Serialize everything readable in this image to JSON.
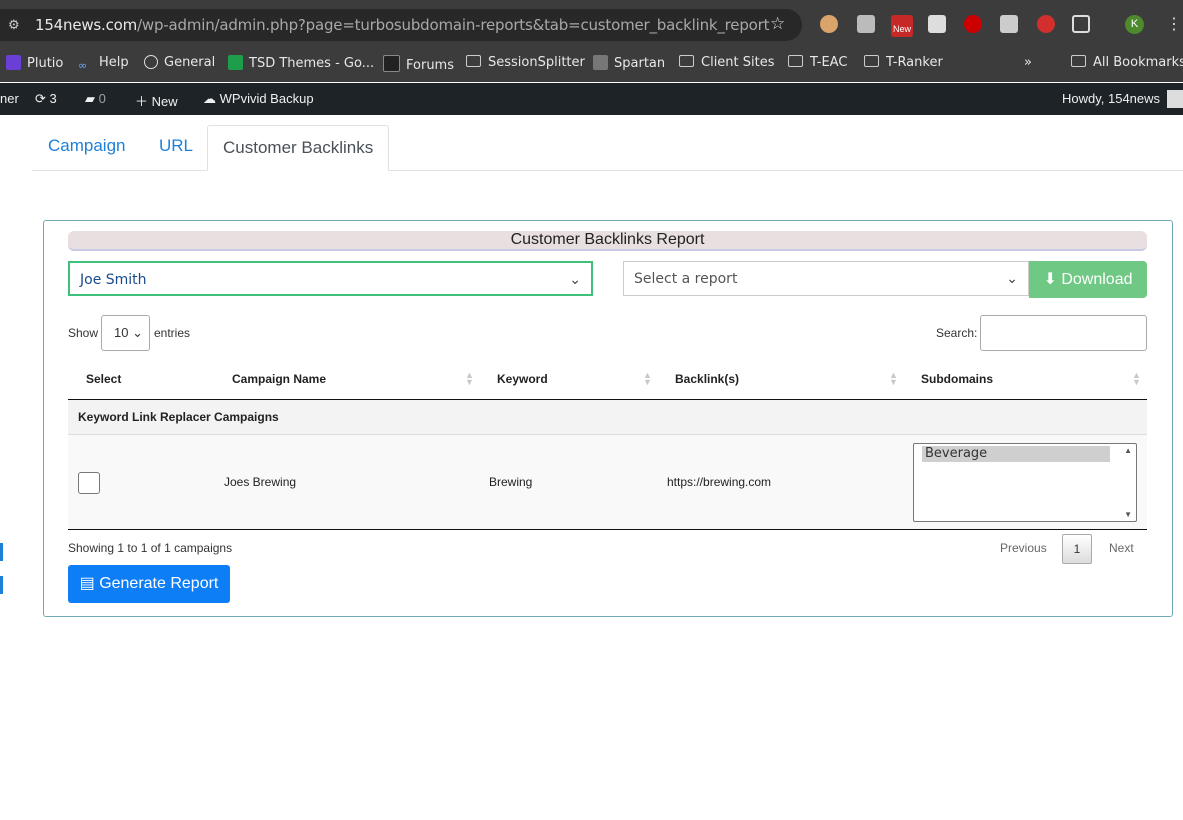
{
  "browser": {
    "url_host": "154news.com",
    "url_path": "/wp-admin/admin.php?page=turbosubdomain-reports&tab=customer_backlink_report",
    "extension_badge": "New",
    "profile_initial": "K",
    "bookmarks": [
      "Plutio",
      "Help",
      "General",
      "TSD Themes - Go...",
      "Forums",
      "SessionSplitter",
      "Spartan",
      "Client Sites",
      "T-EAC",
      "T-Ranker"
    ],
    "all_bookmarks": "All Bookmarks"
  },
  "adminbar": {
    "site_fragment": "ner",
    "updates": "3",
    "comments": "0",
    "new_label": "New",
    "plugin_label": "WPvivid Backup",
    "howdy": "Howdy, 154news"
  },
  "tabs": [
    "Campaign",
    "URL",
    "Customer Backlinks"
  ],
  "report": {
    "title": "Customer Backlinks Report",
    "customer_select": "Joe Smith",
    "report_select_placeholder": "Select a report",
    "download_label": "Download",
    "show_label": "Show",
    "entries_value": "10",
    "entries_label": "entries",
    "search_label": "Search:",
    "columns": [
      "Select",
      "Campaign Name",
      "Keyword",
      "Backlink(s)",
      "Subdomains"
    ],
    "group_label": "Keyword Link Replacer Campaigns",
    "row": {
      "campaign": "Joes Brewing",
      "keyword": "Brewing",
      "backlink": "https://brewing.com",
      "subdomain": "Beverage"
    },
    "info": "Showing 1 to 1 of 1 campaigns",
    "prev": "Previous",
    "page": "1",
    "next": "Next",
    "generate_label": "Generate Report"
  },
  "colors": {
    "accent_blue": "#0d7ef5",
    "download_green": "#6fc883",
    "select_border_green": "#3ec07a",
    "adminbar_bg": "#1d2327"
  }
}
